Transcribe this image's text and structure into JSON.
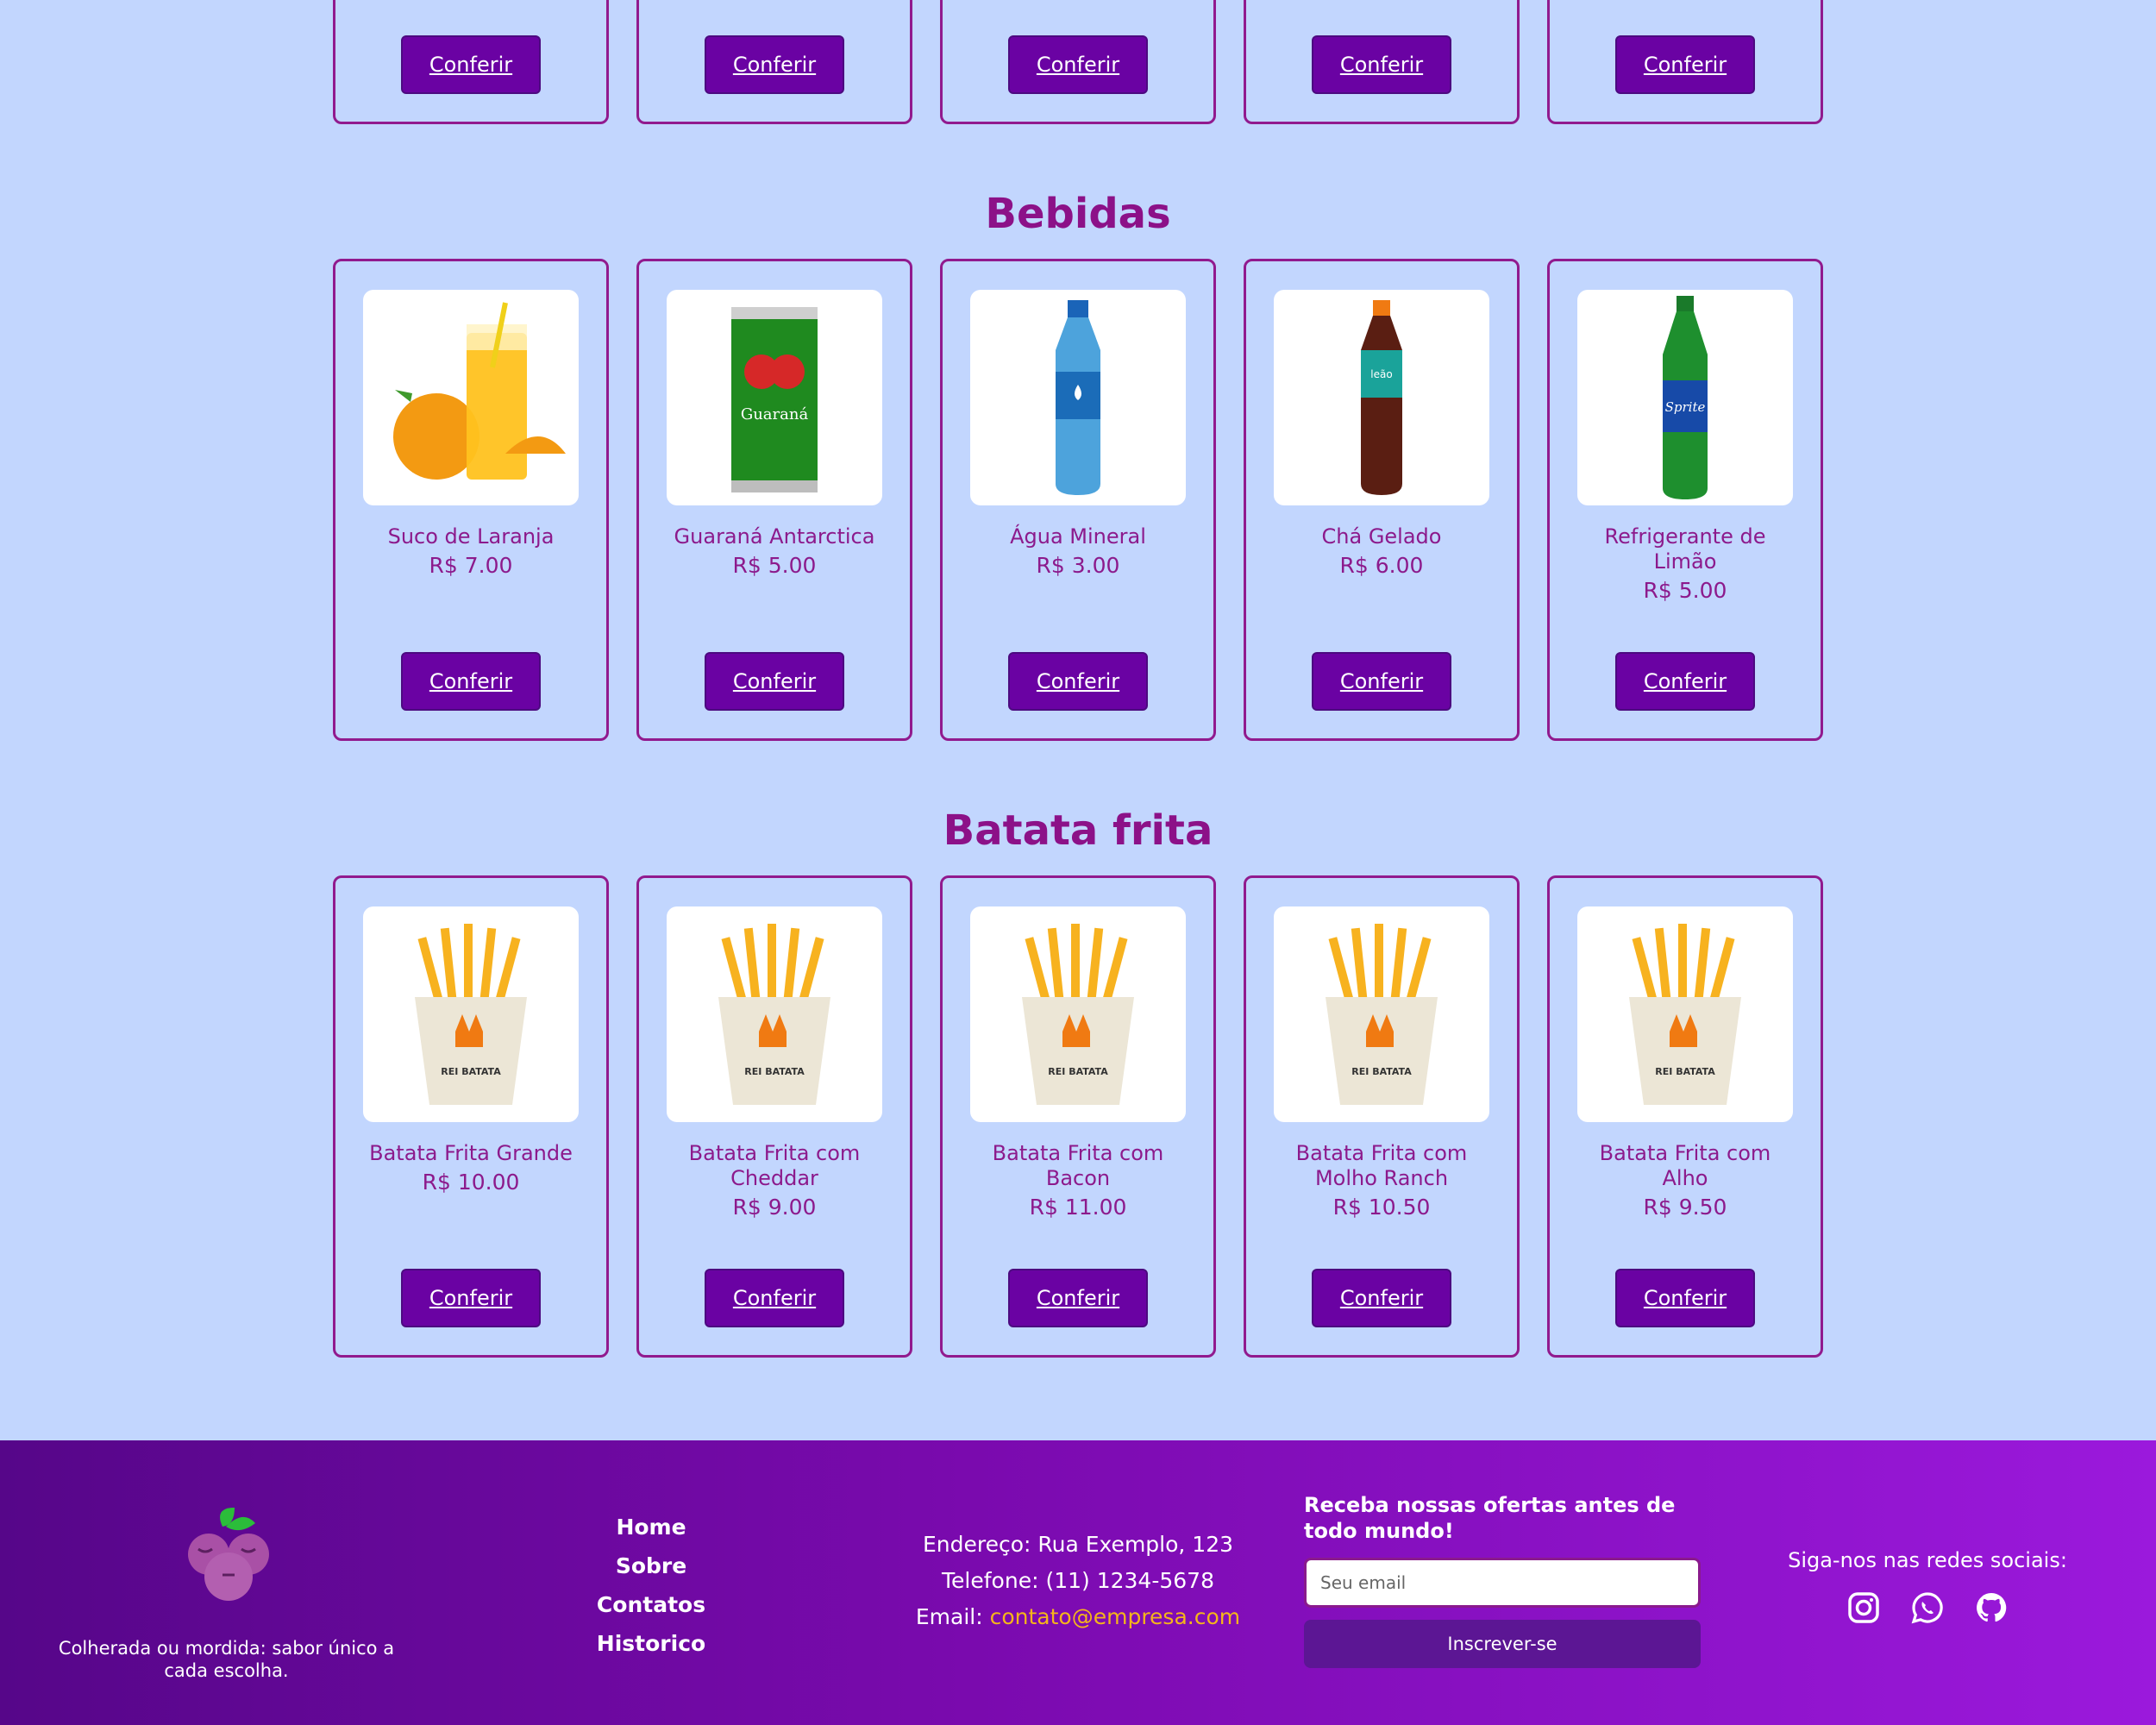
{
  "top_row": {
    "cards": [
      {
        "button": "Conferir"
      },
      {
        "button": "Conferir"
      },
      {
        "button": "Conferir"
      },
      {
        "button": "Conferir"
      },
      {
        "button": "Conferir"
      }
    ]
  },
  "sections": [
    {
      "title": "Bebidas",
      "products": [
        {
          "name": "Suco de Laranja",
          "price": "R$ 7.00",
          "button": "Conferir",
          "image": "orange-juice-image"
        },
        {
          "name": "Guaraná Antarctica",
          "price": "R$ 5.00",
          "button": "Conferir",
          "image": "soda-can-image"
        },
        {
          "name": "Água Mineral",
          "price": "R$ 3.00",
          "button": "Conferir",
          "image": "water-bottle-image"
        },
        {
          "name": "Chá Gelado",
          "price": "R$ 6.00",
          "button": "Conferir",
          "image": "iced-tea-bottle-image"
        },
        {
          "name": "Refrigerante de Limão",
          "price": "R$ 5.00",
          "button": "Conferir",
          "image": "lemon-soda-bottle-image"
        }
      ]
    },
    {
      "title": "Batata frita",
      "products": [
        {
          "name": "Batata Frita Grande",
          "price": "R$ 10.00",
          "button": "Conferir",
          "image": "fries-image"
        },
        {
          "name": "Batata Frita com Cheddar",
          "price": "R$ 9.00",
          "button": "Conferir",
          "image": "fries-image"
        },
        {
          "name": "Batata Frita com Bacon",
          "price": "R$ 11.00",
          "button": "Conferir",
          "image": "fries-image"
        },
        {
          "name": "Batata Frita com Molho Ranch",
          "price": "R$ 10.50",
          "button": "Conferir",
          "image": "fries-image"
        },
        {
          "name": "Batata Frita com Alho",
          "price": "R$ 9.50",
          "button": "Conferir",
          "image": "fries-image"
        }
      ]
    }
  ],
  "footer": {
    "tagline": "Colherada ou mordida: sabor único a cada escolha.",
    "nav": [
      "Home",
      "Sobre",
      "Contatos",
      "Historico"
    ],
    "address": "Endereço: Rua Exemplo, 123",
    "phone": "Telefone: (11) 1234-5678",
    "email_label": "Email: ",
    "email": "contato@empresa.com",
    "newsletter_title": "Receba nossas ofertas antes de todo mundo!",
    "newsletter_placeholder": "Seu email",
    "newsletter_button": "Inscrever-se",
    "social_title": "Siga-nos nas redes sociais:",
    "social_icons": [
      "instagram-icon",
      "whatsapp-icon",
      "github-icon"
    ]
  },
  "colors": {
    "page_bg": "#c2d6fe",
    "accent": "#6a02a3",
    "card_border": "#911a8e",
    "email_link": "#f5b51a"
  }
}
